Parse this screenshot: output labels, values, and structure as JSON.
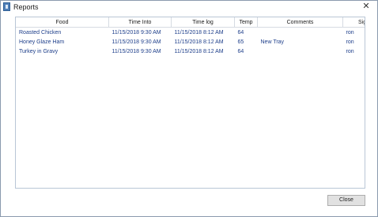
{
  "window": {
    "title": "Reports",
    "icon": "report-icon"
  },
  "table": {
    "columns": [
      "Food",
      "Time Into",
      "Time log",
      "Temp",
      "Comments",
      "Sign"
    ],
    "rows": [
      {
        "food": "Roasted Chicken",
        "time_into": "11/15/2018 9:30 AM",
        "time_log": "11/15/2018 8:12 AM",
        "temp": "64",
        "comments": "",
        "sign": "ron"
      },
      {
        "food": "Honey Glaze Ham",
        "time_into": "11/15/2018 9:30 AM",
        "time_log": "11/15/2018 8:12 AM",
        "temp": "65",
        "comments": "New Tray",
        "sign": "ron"
      },
      {
        "food": "Turkey in Gravy",
        "time_into": "11/15/2018 9:30 AM",
        "time_log": "11/15/2018 8:12 AM",
        "temp": "64",
        "comments": "",
        "sign": "ron"
      }
    ]
  },
  "buttons": {
    "close_label": "Close"
  },
  "colors": {
    "cell_text": "#1d3e8a",
    "window_border": "#8a9aae"
  }
}
